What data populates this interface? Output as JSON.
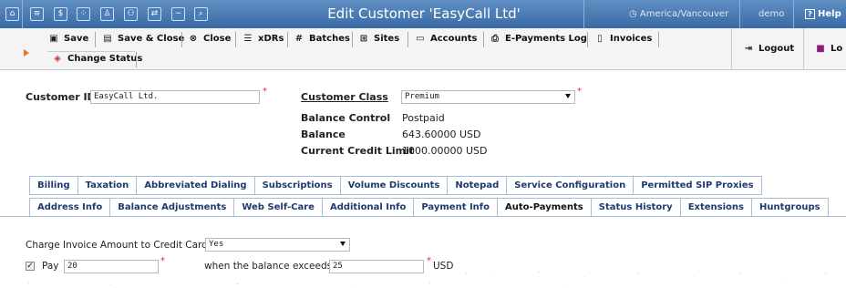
{
  "header": {
    "title": "Edit Customer 'EasyCall Ltd'",
    "timezone": "America/Vancouver",
    "user": "demo",
    "help": "Help",
    "icons": [
      "home-icon",
      "list-icon",
      "dollar-icon",
      "network-icon",
      "person-icon",
      "users-icon",
      "transfer-icon",
      "chart-icon",
      "search-icon"
    ]
  },
  "toolbar": {
    "save": "Save",
    "save_close": "Save & Close",
    "close": "Close",
    "xdrs": "xDRs",
    "batches": "Batches",
    "sites": "Sites",
    "accounts": "Accounts",
    "epayments": "E-Payments Log",
    "invoices": "Invoices",
    "change_status": "Change Status",
    "logout": "Logout",
    "log_right": "Lo"
  },
  "form": {
    "customer_id_label": "Customer ID",
    "customer_id_value": "EasyCall Ltd.",
    "customer_class_label": "Customer Class",
    "customer_class_value": "Premium",
    "balance_control_label": "Balance Control",
    "balance_control_value": "Postpaid",
    "balance_label": "Balance",
    "balance_value": "643.60000 USD",
    "credit_limit_label": "Current Credit Limit",
    "credit_limit_value": "1000.00000 USD"
  },
  "tabs": {
    "row1": [
      "Billing",
      "Taxation",
      "Abbreviated Dialing",
      "Subscriptions",
      "Volume Discounts",
      "Notepad",
      "Service Configuration",
      "Permitted SIP Proxies"
    ],
    "row2": [
      "Address Info",
      "Balance Adjustments",
      "Web Self-Care",
      "Additional Info",
      "Payment Info",
      "Auto-Payments",
      "Status History",
      "Extensions",
      "Huntgroups"
    ],
    "active": "Auto-Payments"
  },
  "autopay": {
    "charge_label": "Charge Invoice Amount to Credit Card",
    "charge_value": "Yes",
    "pay_label": "Pay",
    "pay_value": "20",
    "when_label": "when the balance exceeds",
    "threshold_value": "25",
    "currency": "USD",
    "pay_checked": true
  },
  "colors": {
    "header": "#3a6aa6",
    "tab_text": "#1e3a6e",
    "required": "#e23"
  }
}
